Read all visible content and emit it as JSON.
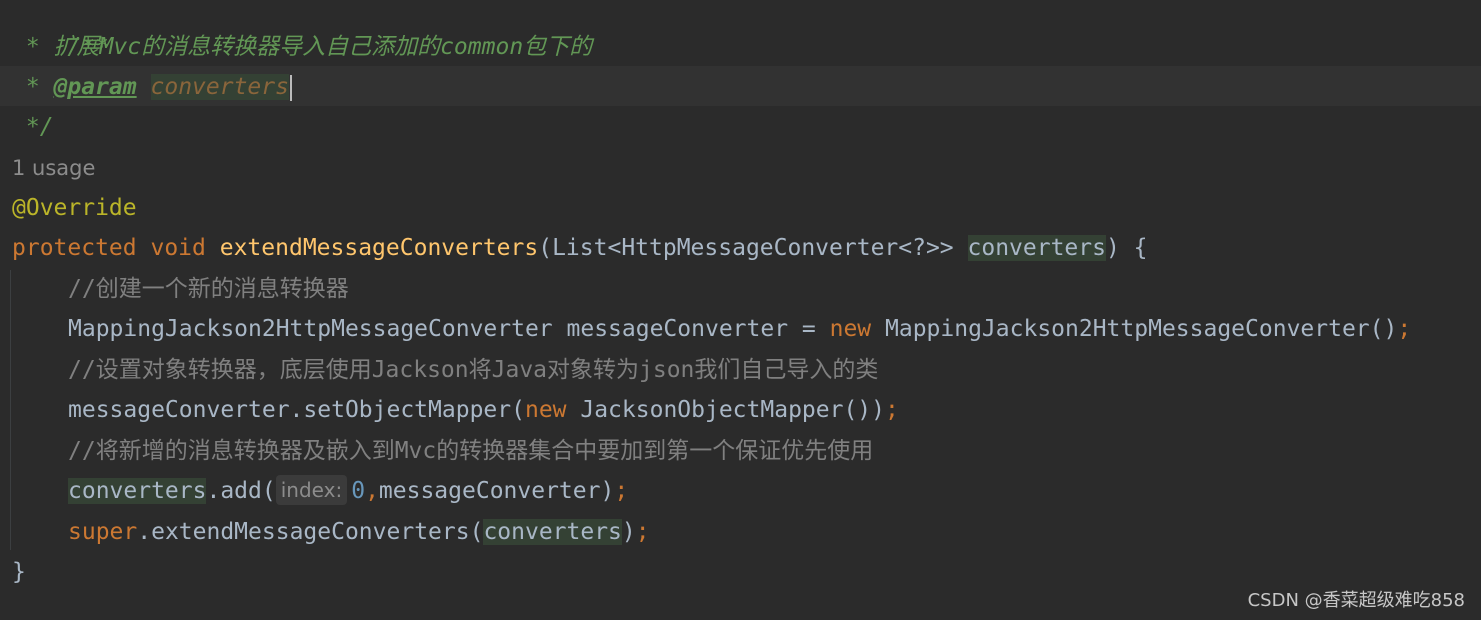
{
  "doc_comment": {
    "open": "/**",
    "summary_prefix": " * ",
    "summary": "扩展Mvc的消息转换器导入自己添加的common包下的",
    "param_prefix": " * ",
    "param_tag": "@param",
    "param_name": "converters",
    "close": " */"
  },
  "usage_hint": "1 usage",
  "annotation": "@Override",
  "signature": {
    "modifier": "protected",
    "return_type": "void",
    "method_name": "extendMessageConverters",
    "param_type": "(List<HttpMessageConverter<?>> ",
    "param_name": "converters",
    "close": ") {"
  },
  "body": {
    "comment1": "//创建一个新的消息转换器",
    "line2_type": "MappingJackson2HttpMessageConverter messageConverter = ",
    "line2_new": "new",
    "line2_ctor": " MappingJackson2HttpMessageConverter()",
    "semicolon": ";",
    "comment2": "//设置对象转换器，底层使用Jackson将Java对象转为json我们自己导入的类",
    "line4_call": "messageConverter.setObjectMapper(",
    "line4_new": "new",
    "line4_ctor": " JacksonObjectMapper())",
    "comment3": "//将新增的消息转换器及嵌入到Mvc的转换器集合中要加到第一个保证优先使用",
    "line6_target": "converters",
    "line6_call": ".add(",
    "line6_hint": "index:",
    "line6_index": "0",
    "line6_comma": ",",
    "line6_arg": "messageConverter)",
    "line7_super": "super",
    "line7_call": ".extendMessageConverters(",
    "line7_arg": "converters",
    "line7_close": ")"
  },
  "closing_brace": "}",
  "watermark": "CSDN @香菜超级难吃858",
  "colors": {
    "background": "#2b2b2b",
    "keyword": "#cc7832",
    "method_name": "#ffc66d",
    "annotation": "#bbb529",
    "doc_comment": "#629755",
    "line_comment": "#808080",
    "number": "#6897bb",
    "default_text": "#a9b7c6"
  }
}
